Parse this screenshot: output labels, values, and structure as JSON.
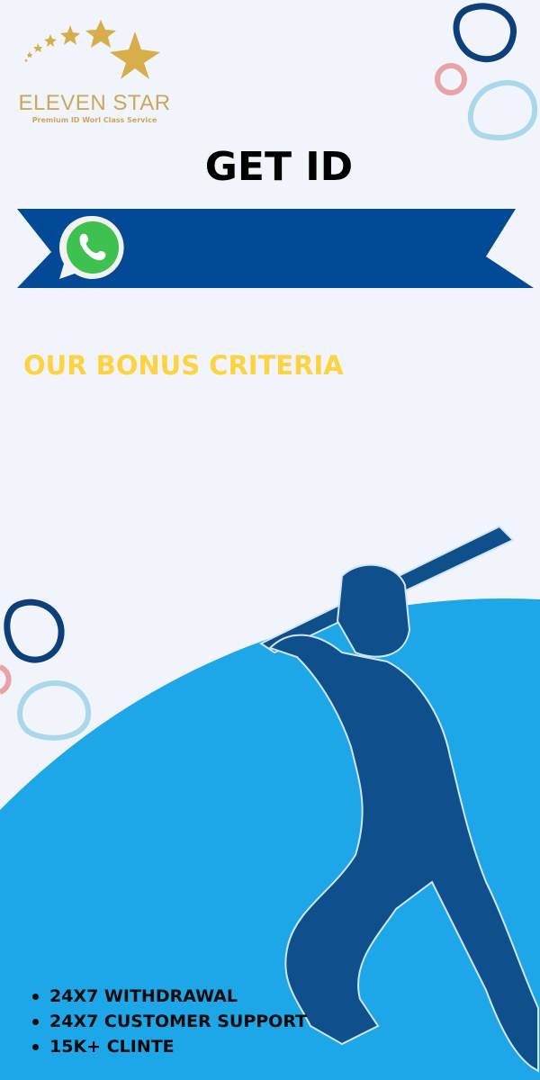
{
  "brand": {
    "name": "ELEVEN STAR",
    "tagline": "Premium ID Worl Class Service"
  },
  "headline": "GET ID",
  "contact_banner": {
    "icon": "whatsapp-icon"
  },
  "bonus_heading": "OUR BONUS CRITERIA",
  "features": [
    "24X7 WITHDRAWAL",
    "24X7 CUSTOMER SUPPORT",
    "15K+ CLINTE"
  ],
  "colors": {
    "background": "#f1f4fa",
    "banner": "#034a96",
    "circle": "#1da6e8",
    "gold": "#c9a85c",
    "bonus": "#fed33f",
    "player": "#0f4f8c"
  }
}
